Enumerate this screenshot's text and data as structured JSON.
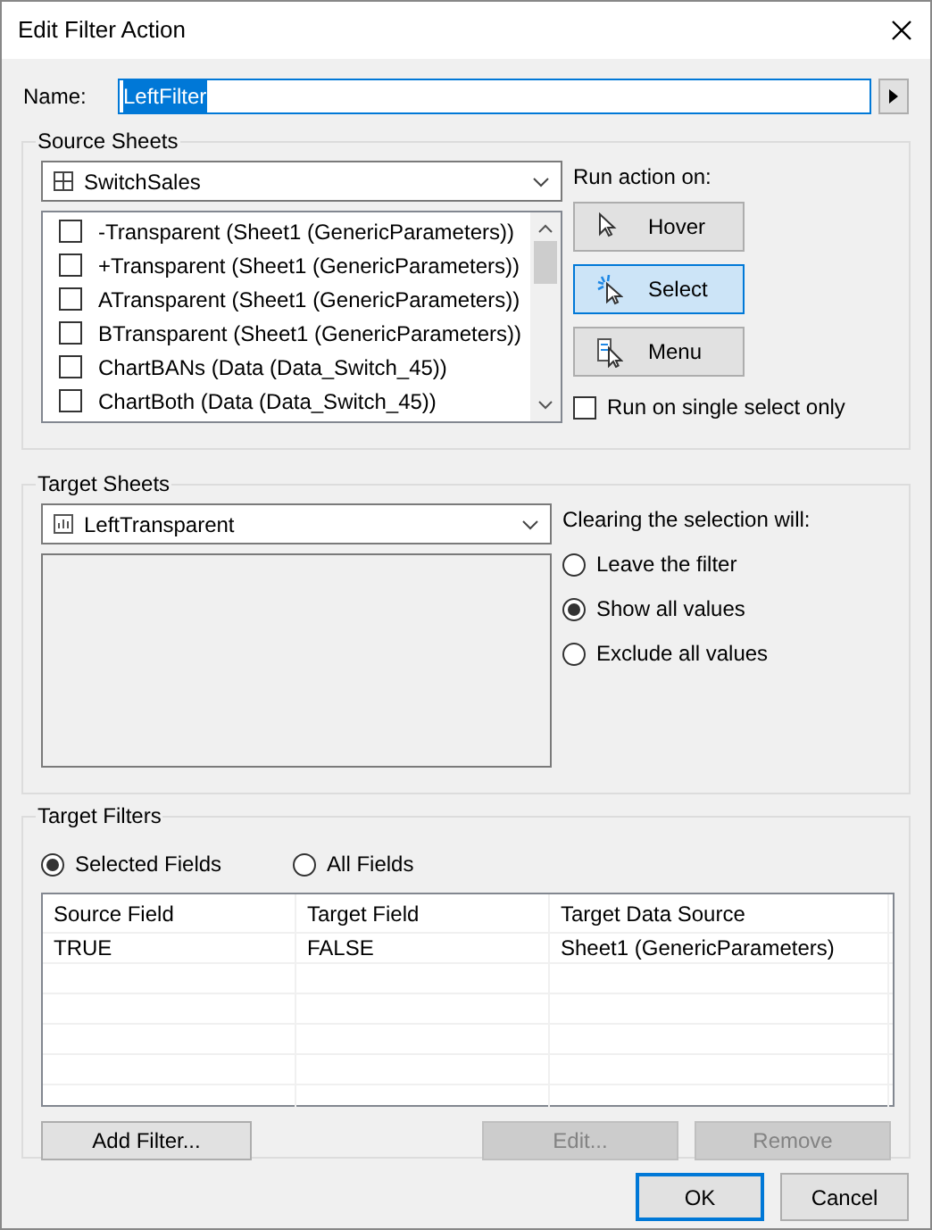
{
  "window": {
    "title": "Edit Filter Action"
  },
  "name_field": {
    "label": "Name:",
    "value": "LeftFilter",
    "selected_text": true
  },
  "source_sheets": {
    "title": "Source Sheets",
    "dataset": "SwitchSales",
    "sheets": [
      {
        "label": "-Transparent (Sheet1 (GenericParameters))",
        "checked": false
      },
      {
        "label": "+Transparent (Sheet1 (GenericParameters))",
        "checked": false
      },
      {
        "label": "ATransparent (Sheet1 (GenericParameters))",
        "checked": false
      },
      {
        "label": "BTransparent (Sheet1 (GenericParameters))",
        "checked": false
      },
      {
        "label": "ChartBANs (Data (Data_Switch_45))",
        "checked": false
      },
      {
        "label": "ChartBoth (Data (Data_Switch_45))",
        "checked": false
      }
    ],
    "run_on_label": "Run action on:",
    "run_on": [
      {
        "label": "Hover",
        "kind": "hover",
        "selected": false
      },
      {
        "label": "Select",
        "kind": "select",
        "selected": true
      },
      {
        "label": "Menu",
        "kind": "menu",
        "selected": false
      }
    ],
    "single_select": {
      "label": "Run on single select only",
      "checked": false
    }
  },
  "target_sheets": {
    "title": "Target Sheets",
    "sheet": "LeftTransparent",
    "clearing_label": "Clearing the selection will:",
    "clearing_options": [
      {
        "label": "Leave the filter",
        "selected": false
      },
      {
        "label": "Show all values",
        "selected": true
      },
      {
        "label": "Exclude all values",
        "selected": false
      }
    ]
  },
  "target_filters": {
    "title": "Target Filters",
    "scope": [
      {
        "label": "Selected Fields",
        "selected": true
      },
      {
        "label": "All Fields",
        "selected": false
      }
    ],
    "table": {
      "columns": [
        "Source Field",
        "Target Field",
        "Target Data Source"
      ],
      "rows": [
        [
          "TRUE",
          "FALSE",
          "Sheet1 (GenericParameters)"
        ]
      ]
    },
    "buttons": [
      {
        "label": "Add Filter...",
        "disabled": false
      },
      {
        "label": "Edit...",
        "disabled": true
      },
      {
        "label": "Remove",
        "disabled": true
      }
    ]
  },
  "footer_buttons": [
    {
      "label": "OK",
      "default": true
    },
    {
      "label": "Cancel",
      "default": false
    }
  ]
}
